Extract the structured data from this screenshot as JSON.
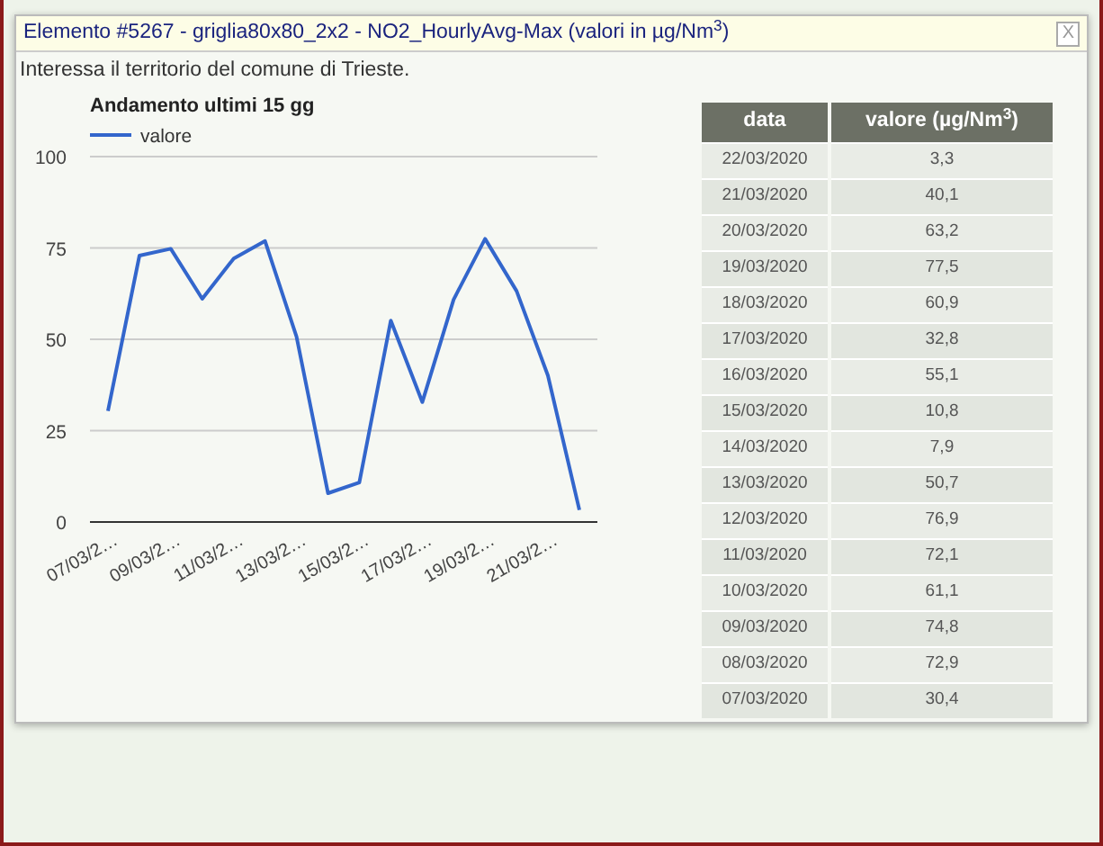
{
  "popup": {
    "title": "Elemento #5267 - griglia80x80_2x2 - NO2_HourlyAvg-Max (valori in µg/Nm$^{3}$)",
    "close": "X",
    "subtitle": "Interessa il territorio del comune di Trieste.",
    "chart": {
      "chart_data": {
        "type": "line",
        "title": "Andamento ultimi 15 gg",
        "series": [
          {
            "name": "valore",
            "color": "#3366cc",
            "values": [
              30.4,
              72.9,
              74.8,
              61.1,
              72.1,
              76.9,
              50.7,
              7.9,
              10.8,
              55.1,
              32.8,
              60.9,
              77.5,
              63.2,
              40.1,
              3.3
            ]
          }
        ],
        "ylim": [
          0,
          100
        ],
        "yticks": [
          0,
          25,
          50,
          75,
          100
        ],
        "grid": true,
        "categories": [
          "07/03/2…",
          null,
          "09/03/2…",
          null,
          "11/03/2…",
          null,
          "13/03/2…",
          null,
          "15/03/2…",
          null,
          "17/03/2…",
          null,
          "19/03/2…",
          null,
          "21/03/2…",
          null
        ]
      }
    },
    "table": {
      "columns": [
        "data",
        "valore (µg/Nm$^{3}$)"
      ],
      "rows": [
        [
          "22/03/2020",
          "3,3"
        ],
        [
          "21/03/2020",
          "40,1"
        ],
        [
          "20/03/2020",
          "63,2"
        ],
        [
          "19/03/2020",
          "77,5"
        ],
        [
          "18/03/2020",
          "60,9"
        ],
        [
          "17/03/2020",
          "32,8"
        ],
        [
          "16/03/2020",
          "55,1"
        ],
        [
          "15/03/2020",
          "10,8"
        ],
        [
          "14/03/2020",
          "7,9"
        ],
        [
          "13/03/2020",
          "50,7"
        ],
        [
          "12/03/2020",
          "76,9"
        ],
        [
          "11/03/2020",
          "72,1"
        ],
        [
          "10/03/2020",
          "61,1"
        ],
        [
          "09/03/2020",
          "74,8"
        ],
        [
          "08/03/2020",
          "72,9"
        ],
        [
          "07/03/2020",
          "30,4"
        ]
      ]
    }
  }
}
